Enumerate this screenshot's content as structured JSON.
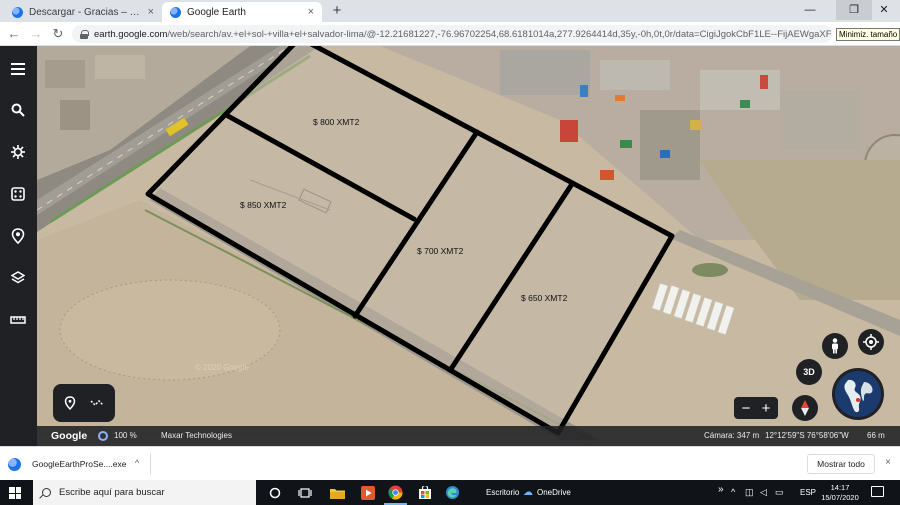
{
  "browser": {
    "tabs": [
      {
        "title": "Descargar - Gracias – Google Ear",
        "close": "×"
      },
      {
        "title": "Google Earth",
        "close": "×"
      }
    ],
    "new_tab_label": "+",
    "window_controls": {
      "minimize": "—",
      "maximize": "❐",
      "close": "✕"
    },
    "nav": {
      "back": "←",
      "forward": "→",
      "reload": "↻"
    },
    "url_host": "earth.google.com",
    "url_path": "/web/search/av.+el+sol-+villa+el+salvador-lima/@-12.21681227,-76.96702254,68.6181014a,277.9264414d,35y,-0h,0t,0r/data=CigiJgokCbF1LE--FijAEWgaXFX2G...",
    "tooltip": "Minimiz. tamaño"
  },
  "earth": {
    "lots": [
      {
        "price": "$ 800 XMT2"
      },
      {
        "price": "$ 850 XMT2"
      },
      {
        "price": "$ 700 XMT2"
      },
      {
        "price": "$ 650 XMT2"
      }
    ],
    "sidebar_icons": [
      "menu-icon",
      "search-icon",
      "voyager-icon",
      "dice-icon",
      "projects-icon",
      "layers-icon",
      "measure-icon"
    ],
    "view_3d_label": "3D",
    "zoom_out": "−",
    "zoom_in": "+",
    "bottom_bar": {
      "logo": "Google",
      "zoom_level": "100 %",
      "imagery_credit": "Maxar Technologies",
      "camera": "Cámara: 347 m",
      "coordinates": "12°12'59\"S 76°58'06\"W",
      "scale": "66 m"
    },
    "watermark": "© 2020 Google"
  },
  "download_shelf": {
    "file_name": "GoogleEarthProSe....exe",
    "caret": "^",
    "show_all": "Mostrar todo",
    "close": "×"
  },
  "taskbar": {
    "search_placeholder": "Escribe aquí para buscar",
    "tray_desktop": "Escritorio",
    "onedrive": "OneDrive",
    "tray_more": "»",
    "language": "ESP",
    "time": "14:17",
    "date": "15/07/2020"
  },
  "colors": {
    "boundary": "#000000",
    "sidebar": "#202124",
    "accent": "#8ab4f8",
    "taskbar": "#101419"
  }
}
